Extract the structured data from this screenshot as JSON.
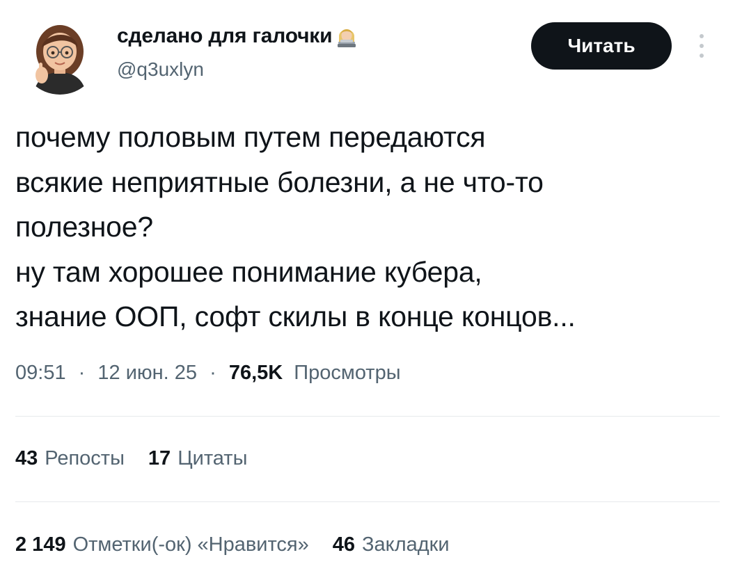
{
  "header": {
    "display_name": "сделано для галочки",
    "handle": "@q3uxlyn",
    "follow_button": "Читать"
  },
  "tweet": {
    "lines": [
      "почему половым путем передаются",
      "всякие неприятные болезни, а не что-то",
      "полезное?",
      "ну там хорошее понимание кубера,",
      "знание ООП, софт скилы в конце концов..."
    ]
  },
  "meta": {
    "time": "09:51",
    "separator": "·",
    "date": "12 июн. 25",
    "views_count": "76,5K",
    "views_label": "Просмотры"
  },
  "stats_row1": [
    {
      "count": "43",
      "label": "Репосты"
    },
    {
      "count": "17",
      "label": "Цитаты"
    }
  ],
  "stats_row2": [
    {
      "count": "2 149",
      "label": "Отметки(-ок) «Нравится»"
    },
    {
      "count": "46",
      "label": "Закладки"
    }
  ],
  "icons": {
    "avatar": "memoji-avatar",
    "name_emoji": "woman-technologist-emoji",
    "more": "more-vertical-icon"
  }
}
